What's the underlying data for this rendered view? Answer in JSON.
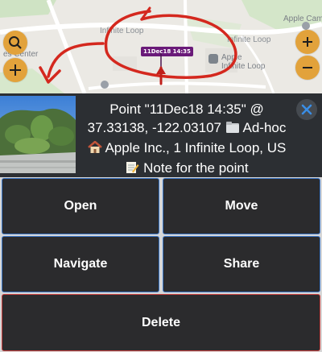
{
  "map": {
    "road_labels": [
      "Infinite Loop",
      "Infinite Loop"
    ],
    "place_labels": {
      "apple_campus": "Apple Campu",
      "apple_store_line1": "Apple",
      "apple_store_line2": "Infinite Loop",
      "left_label_line1": "y",
      "left_label_line2": "es Center",
      "infinite_loop_left": "infinite Loop"
    },
    "pin_label": "11Dec18 14:35",
    "annotation_color": "#d4281e"
  },
  "point": {
    "title_line1": "Point \"11Dec18 14:35\" @",
    "title_line2": "37.33138, -122.03107",
    "category": "Ad-hoc",
    "address": "Apple Inc., 1 Infinite Loop, US",
    "note": "Note for the point",
    "icons": [
      "folder-icon",
      "house-icon",
      "memo-icon"
    ]
  },
  "actions": {
    "open": "Open",
    "move": "Move",
    "navigate": "Navigate",
    "share": "Share",
    "delete": "Delete"
  },
  "colors": {
    "map_button": "#e2a23b",
    "panel_bg": "#2c2f33",
    "button_bg": "#2b2b2d",
    "button_border_blue": "#3d78c9",
    "button_border_red": "#c84040",
    "pin_bg": "#6a1a79",
    "close_x": "#3a8ee6"
  }
}
